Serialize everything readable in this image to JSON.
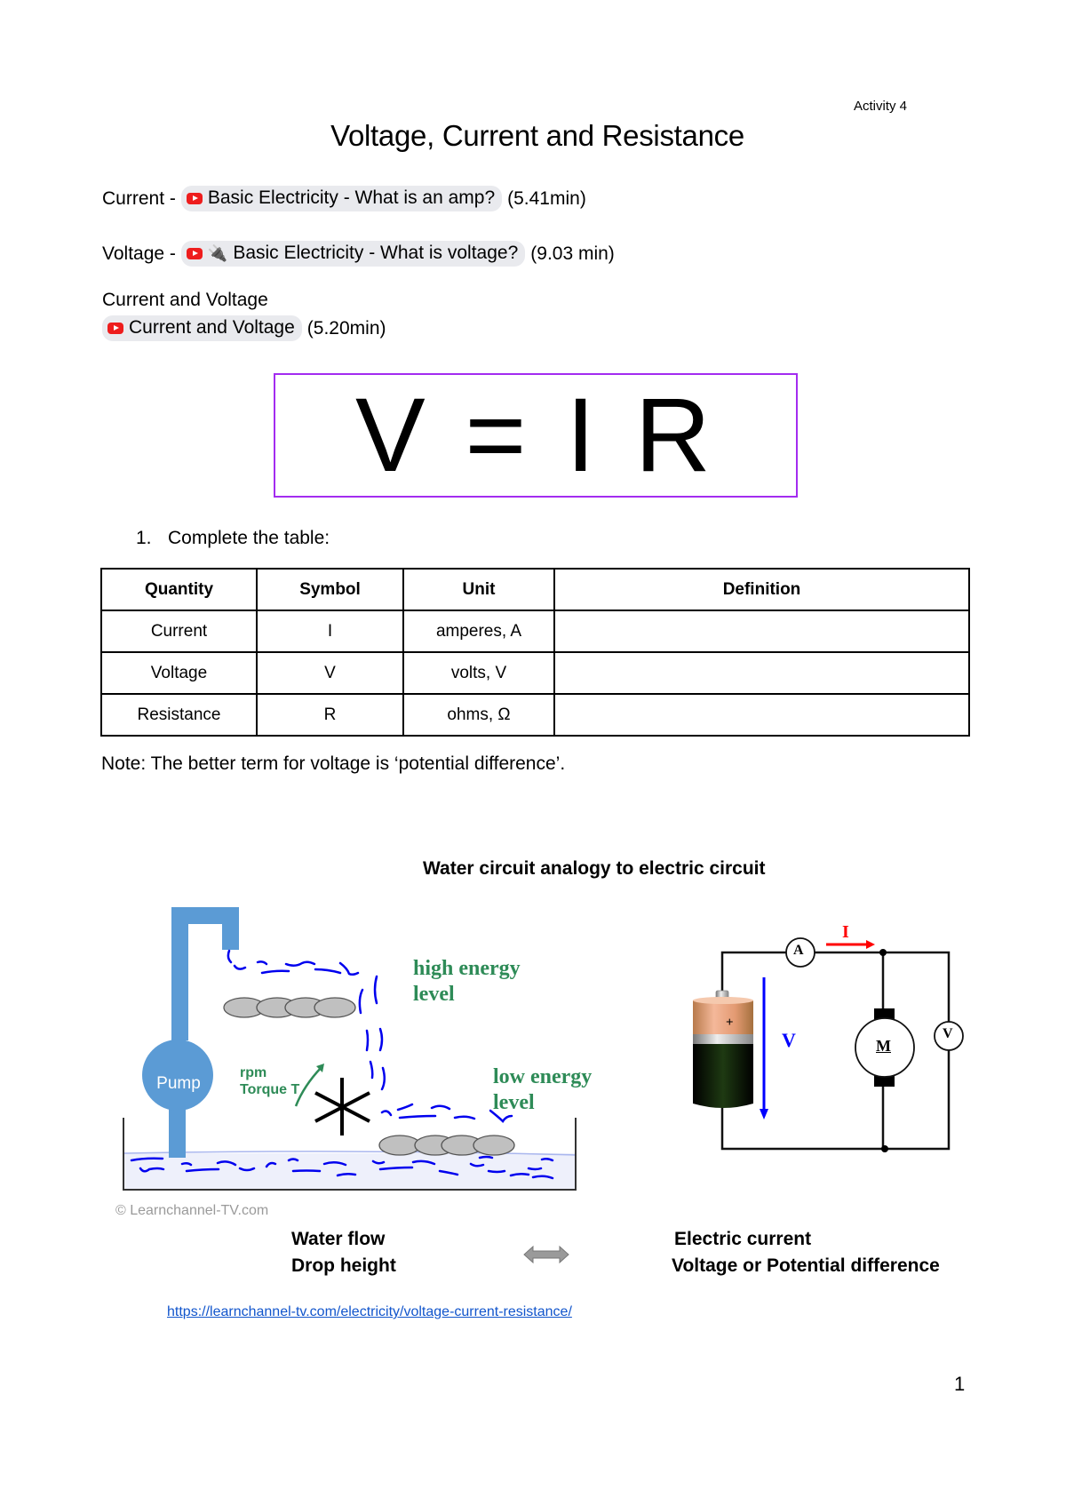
{
  "header": {
    "activity": "Activity 4"
  },
  "title": "Voltage, Current and Resistance",
  "resources": [
    {
      "prefix": "Current -",
      "icons": [
        "youtube-icon"
      ],
      "link_text": "Basic Electricity - What is an amp?",
      "duration": "(5.41min)"
    },
    {
      "prefix": "Voltage -",
      "icons": [
        "youtube-icon",
        "plug-icon"
      ],
      "link_text": "Basic Electricity - What is voltage?",
      "duration": "(9.03 min)"
    },
    {
      "heading": "Current and Voltage",
      "icons": [
        "youtube-icon"
      ],
      "link_text": "Current and Voltage",
      "duration": "(5.20min)"
    }
  ],
  "icons": {
    "plug": "🔌"
  },
  "equation": "V = I R",
  "equation_border_color": "#a32cf0",
  "question": {
    "number": "1.",
    "text": "Complete the table:"
  },
  "table": {
    "headers": [
      "Quantity",
      "Symbol",
      "Unit",
      "Definition"
    ],
    "rows": [
      [
        "Current",
        "I",
        "amperes, A",
        ""
      ],
      [
        "Voltage",
        "V",
        "volts, V",
        ""
      ],
      [
        "Resistance",
        "R",
        "ohms, Ω",
        ""
      ]
    ]
  },
  "note": "Note: The better term for voltage is ‘potential difference’.",
  "diagram": {
    "title": "Water circuit analogy to electric circuit",
    "water": {
      "pump_label": "Pump",
      "rpm_label": "rpm",
      "torque_label": "Torque T",
      "high_energy": [
        "high energy",
        "level"
      ],
      "low_energy": [
        "low energy",
        "level"
      ],
      "copyright": "© Learnchannel-TV.com"
    },
    "circuit": {
      "ammeter": "A",
      "voltmeter": "V",
      "motor": "M",
      "current_label": "I",
      "voltage_label": "V",
      "battery_polarity": "+"
    },
    "analogy_left": [
      "Water flow",
      "Drop height"
    ],
    "analogy_right": [
      "Electric current",
      "Voltage or Potential difference"
    ],
    "colors": {
      "pipe": "#5b9bd5",
      "label_green": "#2e8b57",
      "current_red": "#ff0000",
      "voltage_blue": "#0000ff",
      "water_dash": "#0000ee"
    }
  },
  "source_link": "https://learnchannel-tv.com/electricity/voltage-current-resistance/",
  "page_number": "1"
}
